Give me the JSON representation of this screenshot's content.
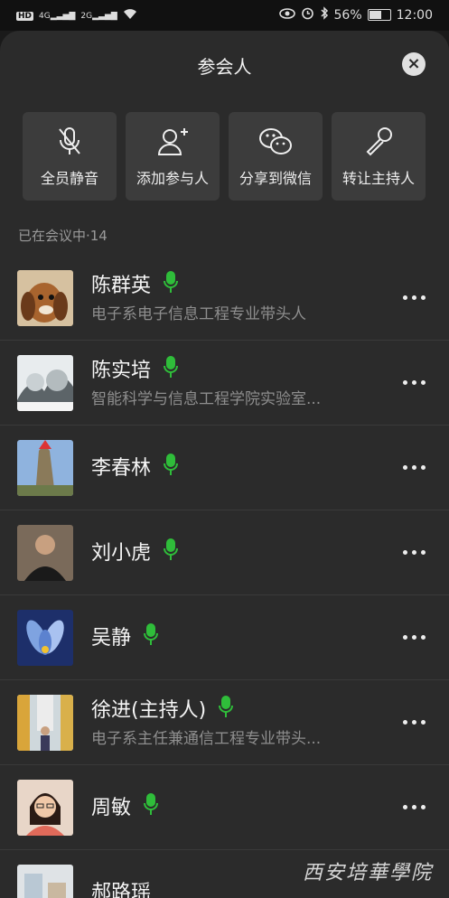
{
  "status_bar": {
    "network_left": "HD",
    "signal1": "4G",
    "signal2": "2G",
    "battery": "56%",
    "battery_level": 0.56,
    "time": "12:00"
  },
  "sheet": {
    "title": "参会人"
  },
  "actions": [
    {
      "label": "全员静音",
      "icon": "mic-off-icon"
    },
    {
      "label": "添加参与人",
      "icon": "add-user-icon"
    },
    {
      "label": "分享到微信",
      "icon": "wechat-icon"
    },
    {
      "label": "转让主持人",
      "icon": "transfer-host-icon"
    }
  ],
  "count_label": "已在会议中·14",
  "participants": [
    {
      "name": "陈群英",
      "desc": "电子系电子信息工程专业带头人",
      "avatar_color": "#b87f4f"
    },
    {
      "name": "陈实培",
      "desc": "智能科学与信息工程学院实验室...",
      "avatar_color": "#9aa3a8"
    },
    {
      "name": "李春林",
      "desc": "",
      "avatar_color": "#7b8fb3"
    },
    {
      "name": "刘小虎",
      "desc": "",
      "avatar_color": "#6f5a4a"
    },
    {
      "name": "吴静",
      "desc": "",
      "avatar_color": "#3f66b8"
    },
    {
      "name": "徐进(主持人)",
      "desc": "电子系主任兼通信工程专业带头...",
      "avatar_color": "#c7a24a"
    },
    {
      "name": "周敏",
      "desc": "",
      "avatar_color": "#c98a7a"
    },
    {
      "name": "郝路瑶",
      "desc": "",
      "avatar_color": "#cfd3d6"
    }
  ],
  "mic_color": "#2fbd3a",
  "watermark": "西安培華學院"
}
